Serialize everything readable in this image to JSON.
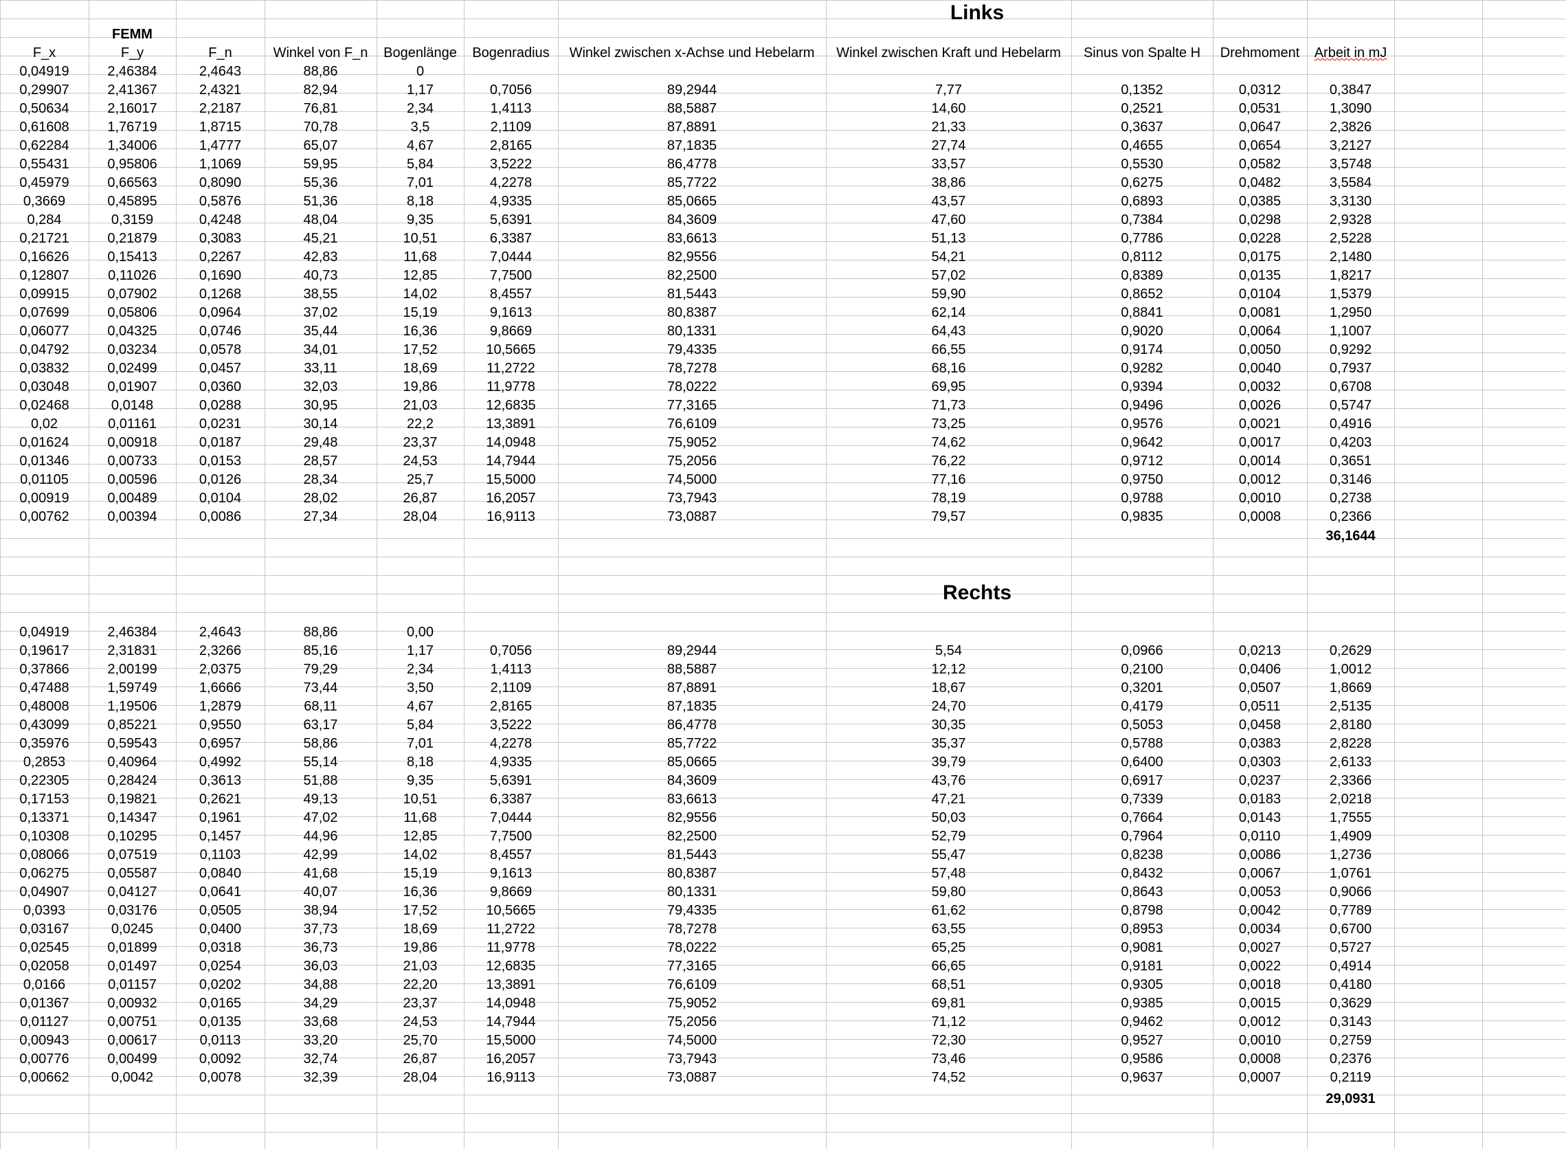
{
  "links": {
    "title": "Links",
    "group_label": "FEMM",
    "headers": [
      "F_x",
      "F_y",
      "F_n",
      "Winkel von F_n",
      "Bogenlänge",
      "Bogenradius",
      "Winkel zwischen x-Achse und Hebelarm",
      "Winkel zwischen Kraft und Hebelarm",
      "Sinus von Spalte H",
      "Drehmoment",
      "Arbeit in mJ"
    ],
    "rows": [
      [
        "0,04919",
        "2,46384",
        "2,4643",
        "88,86",
        "0",
        "",
        "",
        "",
        "",
        "",
        ""
      ],
      [
        "0,29907",
        "2,41367",
        "2,4321",
        "82,94",
        "1,17",
        "0,7056",
        "89,2944",
        "7,77",
        "0,1352",
        "0,0312",
        "0,3847"
      ],
      [
        "0,50634",
        "2,16017",
        "2,2187",
        "76,81",
        "2,34",
        "1,4113",
        "88,5887",
        "14,60",
        "0,2521",
        "0,0531",
        "1,3090"
      ],
      [
        "0,61608",
        "1,76719",
        "1,8715",
        "70,78",
        "3,5",
        "2,1109",
        "87,8891",
        "21,33",
        "0,3637",
        "0,0647",
        "2,3826"
      ],
      [
        "0,62284",
        "1,34006",
        "1,4777",
        "65,07",
        "4,67",
        "2,8165",
        "87,1835",
        "27,74",
        "0,4655",
        "0,0654",
        "3,2127"
      ],
      [
        "0,55431",
        "0,95806",
        "1,1069",
        "59,95",
        "5,84",
        "3,5222",
        "86,4778",
        "33,57",
        "0,5530",
        "0,0582",
        "3,5748"
      ],
      [
        "0,45979",
        "0,66563",
        "0,8090",
        "55,36",
        "7,01",
        "4,2278",
        "85,7722",
        "38,86",
        "0,6275",
        "0,0482",
        "3,5584"
      ],
      [
        "0,3669",
        "0,45895",
        "0,5876",
        "51,36",
        "8,18",
        "4,9335",
        "85,0665",
        "43,57",
        "0,6893",
        "0,0385",
        "3,3130"
      ],
      [
        "0,284",
        "0,3159",
        "0,4248",
        "48,04",
        "9,35",
        "5,6391",
        "84,3609",
        "47,60",
        "0,7384",
        "0,0298",
        "2,9328"
      ],
      [
        "0,21721",
        "0,21879",
        "0,3083",
        "45,21",
        "10,51",
        "6,3387",
        "83,6613",
        "51,13",
        "0,7786",
        "0,0228",
        "2,5228"
      ],
      [
        "0,16626",
        "0,15413",
        "0,2267",
        "42,83",
        "11,68",
        "7,0444",
        "82,9556",
        "54,21",
        "0,8112",
        "0,0175",
        "2,1480"
      ],
      [
        "0,12807",
        "0,11026",
        "0,1690",
        "40,73",
        "12,85",
        "7,7500",
        "82,2500",
        "57,02",
        "0,8389",
        "0,0135",
        "1,8217"
      ],
      [
        "0,09915",
        "0,07902",
        "0,1268",
        "38,55",
        "14,02",
        "8,4557",
        "81,5443",
        "59,90",
        "0,8652",
        "0,0104",
        "1,5379"
      ],
      [
        "0,07699",
        "0,05806",
        "0,0964",
        "37,02",
        "15,19",
        "9,1613",
        "80,8387",
        "62,14",
        "0,8841",
        "0,0081",
        "1,2950"
      ],
      [
        "0,06077",
        "0,04325",
        "0,0746",
        "35,44",
        "16,36",
        "9,8669",
        "80,1331",
        "64,43",
        "0,9020",
        "0,0064",
        "1,1007"
      ],
      [
        "0,04792",
        "0,03234",
        "0,0578",
        "34,01",
        "17,52",
        "10,5665",
        "79,4335",
        "66,55",
        "0,9174",
        "0,0050",
        "0,9292"
      ],
      [
        "0,03832",
        "0,02499",
        "0,0457",
        "33,11",
        "18,69",
        "11,2722",
        "78,7278",
        "68,16",
        "0,9282",
        "0,0040",
        "0,7937"
      ],
      [
        "0,03048",
        "0,01907",
        "0,0360",
        "32,03",
        "19,86",
        "11,9778",
        "78,0222",
        "69,95",
        "0,9394",
        "0,0032",
        "0,6708"
      ],
      [
        "0,02468",
        "0,0148",
        "0,0288",
        "30,95",
        "21,03",
        "12,6835",
        "77,3165",
        "71,73",
        "0,9496",
        "0,0026",
        "0,5747"
      ],
      [
        "0,02",
        "0,01161",
        "0,0231",
        "30,14",
        "22,2",
        "13,3891",
        "76,6109",
        "73,25",
        "0,9576",
        "0,0021",
        "0,4916"
      ],
      [
        "0,01624",
        "0,00918",
        "0,0187",
        "29,48",
        "23,37",
        "14,0948",
        "75,9052",
        "74,62",
        "0,9642",
        "0,0017",
        "0,4203"
      ],
      [
        "0,01346",
        "0,00733",
        "0,0153",
        "28,57",
        "24,53",
        "14,7944",
        "75,2056",
        "76,22",
        "0,9712",
        "0,0014",
        "0,3651"
      ],
      [
        "0,01105",
        "0,00596",
        "0,0126",
        "28,34",
        "25,7",
        "15,5000",
        "74,5000",
        "77,16",
        "0,9750",
        "0,0012",
        "0,3146"
      ],
      [
        "0,00919",
        "0,00489",
        "0,0104",
        "28,02",
        "26,87",
        "16,2057",
        "73,7943",
        "78,19",
        "0,9788",
        "0,0010",
        "0,2738"
      ],
      [
        "0,00762",
        "0,00394",
        "0,0086",
        "27,34",
        "28,04",
        "16,9113",
        "73,0887",
        "79,57",
        "0,9835",
        "0,0008",
        "0,2366"
      ]
    ],
    "total": "36,1644"
  },
  "rechts": {
    "title": "Rechts",
    "rows": [
      [
        "0,04919",
        "2,46384",
        "2,4643",
        "88,86",
        "0,00",
        "",
        "",
        "",
        "",
        "",
        ""
      ],
      [
        "0,19617",
        "2,31831",
        "2,3266",
        "85,16",
        "1,17",
        "0,7056",
        "89,2944",
        "5,54",
        "0,0966",
        "0,0213",
        "0,2629"
      ],
      [
        "0,37866",
        "2,00199",
        "2,0375",
        "79,29",
        "2,34",
        "1,4113",
        "88,5887",
        "12,12",
        "0,2100",
        "0,0406",
        "1,0012"
      ],
      [
        "0,47488",
        "1,59749",
        "1,6666",
        "73,44",
        "3,50",
        "2,1109",
        "87,8891",
        "18,67",
        "0,3201",
        "0,0507",
        "1,8669"
      ],
      [
        "0,48008",
        "1,19506",
        "1,2879",
        "68,11",
        "4,67",
        "2,8165",
        "87,1835",
        "24,70",
        "0,4179",
        "0,0511",
        "2,5135"
      ],
      [
        "0,43099",
        "0,85221",
        "0,9550",
        "63,17",
        "5,84",
        "3,5222",
        "86,4778",
        "30,35",
        "0,5053",
        "0,0458",
        "2,8180"
      ],
      [
        "0,35976",
        "0,59543",
        "0,6957",
        "58,86",
        "7,01",
        "4,2278",
        "85,7722",
        "35,37",
        "0,5788",
        "0,0383",
        "2,8228"
      ],
      [
        "0,2853",
        "0,40964",
        "0,4992",
        "55,14",
        "8,18",
        "4,9335",
        "85,0665",
        "39,79",
        "0,6400",
        "0,0303",
        "2,6133"
      ],
      [
        "0,22305",
        "0,28424",
        "0,3613",
        "51,88",
        "9,35",
        "5,6391",
        "84,3609",
        "43,76",
        "0,6917",
        "0,0237",
        "2,3366"
      ],
      [
        "0,17153",
        "0,19821",
        "0,2621",
        "49,13",
        "10,51",
        "6,3387",
        "83,6613",
        "47,21",
        "0,7339",
        "0,0183",
        "2,0218"
      ],
      [
        "0,13371",
        "0,14347",
        "0,1961",
        "47,02",
        "11,68",
        "7,0444",
        "82,9556",
        "50,03",
        "0,7664",
        "0,0143",
        "1,7555"
      ],
      [
        "0,10308",
        "0,10295",
        "0,1457",
        "44,96",
        "12,85",
        "7,7500",
        "82,2500",
        "52,79",
        "0,7964",
        "0,0110",
        "1,4909"
      ],
      [
        "0,08066",
        "0,07519",
        "0,1103",
        "42,99",
        "14,02",
        "8,4557",
        "81,5443",
        "55,47",
        "0,8238",
        "0,0086",
        "1,2736"
      ],
      [
        "0,06275",
        "0,05587",
        "0,0840",
        "41,68",
        "15,19",
        "9,1613",
        "80,8387",
        "57,48",
        "0,8432",
        "0,0067",
        "1,0761"
      ],
      [
        "0,04907",
        "0,04127",
        "0,0641",
        "40,07",
        "16,36",
        "9,8669",
        "80,1331",
        "59,80",
        "0,8643",
        "0,0053",
        "0,9066"
      ],
      [
        "0,0393",
        "0,03176",
        "0,0505",
        "38,94",
        "17,52",
        "10,5665",
        "79,4335",
        "61,62",
        "0,8798",
        "0,0042",
        "0,7789"
      ],
      [
        "0,03167",
        "0,0245",
        "0,0400",
        "37,73",
        "18,69",
        "11,2722",
        "78,7278",
        "63,55",
        "0,8953",
        "0,0034",
        "0,6700"
      ],
      [
        "0,02545",
        "0,01899",
        "0,0318",
        "36,73",
        "19,86",
        "11,9778",
        "78,0222",
        "65,25",
        "0,9081",
        "0,0027",
        "0,5727"
      ],
      [
        "0,02058",
        "0,01497",
        "0,0254",
        "36,03",
        "21,03",
        "12,6835",
        "77,3165",
        "66,65",
        "0,9181",
        "0,0022",
        "0,4914"
      ],
      [
        "0,0166",
        "0,01157",
        "0,0202",
        "34,88",
        "22,20",
        "13,3891",
        "76,6109",
        "68,51",
        "0,9305",
        "0,0018",
        "0,4180"
      ],
      [
        "0,01367",
        "0,00932",
        "0,0165",
        "34,29",
        "23,37",
        "14,0948",
        "75,9052",
        "69,81",
        "0,9385",
        "0,0015",
        "0,3629"
      ],
      [
        "0,01127",
        "0,00751",
        "0,0135",
        "33,68",
        "24,53",
        "14,7944",
        "75,2056",
        "71,12",
        "0,9462",
        "0,0012",
        "0,3143"
      ],
      [
        "0,00943",
        "0,00617",
        "0,0113",
        "33,20",
        "25,70",
        "15,5000",
        "74,5000",
        "72,30",
        "0,9527",
        "0,0010",
        "0,2759"
      ],
      [
        "0,00776",
        "0,00499",
        "0,0092",
        "32,74",
        "26,87",
        "16,2057",
        "73,7943",
        "73,46",
        "0,9586",
        "0,0008",
        "0,2376"
      ],
      [
        "0,00662",
        "0,0042",
        "0,0078",
        "32,39",
        "28,04",
        "16,9113",
        "73,0887",
        "74,52",
        "0,9637",
        "0,0007",
        "0,2119"
      ]
    ],
    "total": "29,0931"
  }
}
